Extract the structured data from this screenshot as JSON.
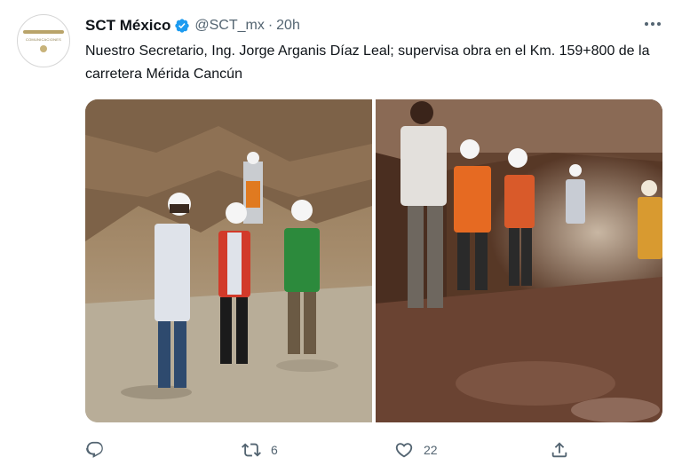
{
  "tweet": {
    "display_name": "SCT México",
    "handle": "@SCT_mx",
    "separator": "·",
    "time": "20h",
    "text": "Nuestro Secretario, Ing. Jorge Arganis Díaz Leal; supervisa obra en el Km. 159+800 de la carretera  Mérida  Cancún",
    "avatar_text": "COMUNICACIONES",
    "photos": [
      {
        "alt_icon": "construction-site-photo"
      },
      {
        "alt_icon": "cave-tunnel-photo"
      }
    ],
    "actions": {
      "reply_icon": "reply-icon",
      "retweet_icon": "retweet-icon",
      "retweet_count": "6",
      "like_icon": "heart-icon",
      "like_count": "22",
      "share_icon": "share-icon"
    }
  },
  "colors": {
    "verified": "#1d9bf0",
    "secondary_text": "#536471",
    "primary_text": "#0f1419"
  }
}
